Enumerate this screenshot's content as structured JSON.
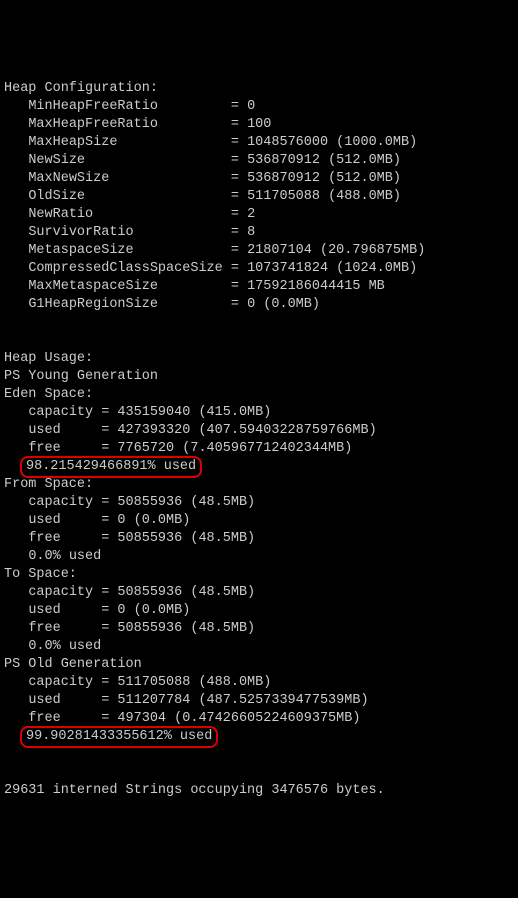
{
  "heap_config": {
    "title": "Heap Configuration:",
    "rows": [
      {
        "key": "MinHeapFreeRatio",
        "val": "0"
      },
      {
        "key": "MaxHeapFreeRatio",
        "val": "100"
      },
      {
        "key": "MaxHeapSize",
        "val": "1048576000 (1000.0MB)"
      },
      {
        "key": "NewSize",
        "val": "536870912 (512.0MB)"
      },
      {
        "key": "MaxNewSize",
        "val": "536870912 (512.0MB)"
      },
      {
        "key": "OldSize",
        "val": "511705088 (488.0MB)"
      },
      {
        "key": "NewRatio",
        "val": "2"
      },
      {
        "key": "SurvivorRatio",
        "val": "8"
      },
      {
        "key": "MetaspaceSize",
        "val": "21807104 (20.796875MB)"
      },
      {
        "key": "CompressedClassSpaceSize",
        "val": "1073741824 (1024.0MB)"
      },
      {
        "key": "MaxMetaspaceSize",
        "val": "17592186044415 MB"
      },
      {
        "key": "G1HeapRegionSize",
        "val": "0 (0.0MB)"
      }
    ]
  },
  "usage_title": "Heap Usage:",
  "young_title": "PS Young Generation",
  "eden": {
    "title": "Eden Space:",
    "capacity": "capacity = 435159040 (415.0MB)",
    "used": "used     = 427393320 (407.59403228759766MB)",
    "free": "free     = 7765720 (7.405967712402344MB)",
    "percent": "98.215429466891% used"
  },
  "from": {
    "title": "From Space:",
    "capacity": "capacity = 50855936 (48.5MB)",
    "used": "used     = 0 (0.0MB)",
    "free": "free     = 50855936 (48.5MB)",
    "percent": "0.0% used"
  },
  "to": {
    "title": "To Space:",
    "capacity": "capacity = 50855936 (48.5MB)",
    "used": "used     = 0 (0.0MB)",
    "free": "free     = 50855936 (48.5MB)",
    "percent": "0.0% used"
  },
  "old_title": "PS Old Generation",
  "old": {
    "capacity": "capacity = 511705088 (488.0MB)",
    "used": "used     = 511207784 (487.5257339477539MB)",
    "free": "free     = 497304 (0.47426605224609375MB)",
    "percent": "99.90281433355612% used"
  },
  "footer": "29631 interned Strings occupying 3476576 bytes."
}
